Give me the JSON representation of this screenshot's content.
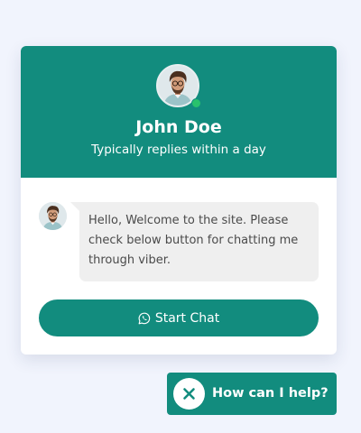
{
  "colors": {
    "page_background": "#f1f4fd",
    "accent": "#128c7e",
    "online": "#29c26d",
    "bubble": "#efefef"
  },
  "agent": {
    "name": "John Doe",
    "status": "Typically replies within a day",
    "online": true
  },
  "message": {
    "text": "Hello, Welcome to the site. Please check below button for chatting me through viber."
  },
  "start_chat": {
    "label": "Start Chat",
    "icon": "whatsapp-icon"
  },
  "launcher": {
    "label": "How can I help?",
    "icon": "close-icon"
  }
}
